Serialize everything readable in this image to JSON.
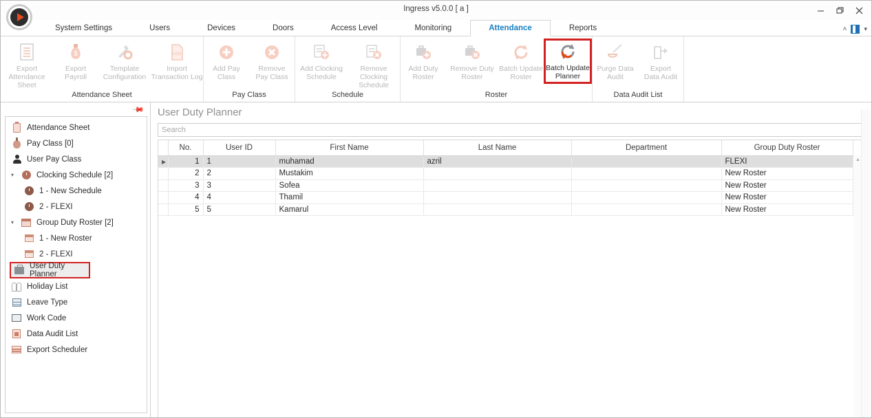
{
  "window": {
    "title": "Ingress v5.0.0 [ a ]",
    "minimize": "—",
    "restore": "❐",
    "close": "✕"
  },
  "logo": {
    "name": "ingress-logo"
  },
  "tabs": [
    {
      "label": "System Settings",
      "active": false
    },
    {
      "label": "Users",
      "active": false
    },
    {
      "label": "Devices",
      "active": false
    },
    {
      "label": "Doors",
      "active": false
    },
    {
      "label": "Access Level",
      "active": false
    },
    {
      "label": "Monitoring",
      "active": false
    },
    {
      "label": "Attendance",
      "active": true
    },
    {
      "label": "Reports",
      "active": false
    }
  ],
  "tabstrip_right": {
    "collapse_ribbon": "˄",
    "office_badge": "office-icon",
    "caret": "▾"
  },
  "ribbon": {
    "groups": [
      {
        "label": "Attendance Sheet",
        "items": [
          {
            "label": "Export\nAttendance Sheet",
            "line1": "Export",
            "line2": "Attendance Sheet",
            "icon": "export-attendance-sheet-icon",
            "enabled": false
          },
          {
            "label": "Export Payroll",
            "line1": "Export",
            "line2": "Payroll",
            "icon": "export-payroll-icon",
            "enabled": false
          },
          {
            "label": "Template Configuration",
            "line1": "Template",
            "line2": "Configuration",
            "icon": "template-configuration-icon",
            "enabled": false
          },
          {
            "label": "Import Transaction Log",
            "line1": "Import",
            "line2": "Transaction Log",
            "icon": "import-transaction-log-icon",
            "enabled": false
          }
        ]
      },
      {
        "label": "Pay Class",
        "items": [
          {
            "line1": "Add Pay",
            "line2": "Class",
            "icon": "add-pay-class-icon",
            "enabled": false
          },
          {
            "line1": "Remove",
            "line2": "Pay Class",
            "icon": "remove-pay-class-icon",
            "enabled": false
          }
        ]
      },
      {
        "label": "Schedule",
        "items": [
          {
            "line1": "Add Clocking",
            "line2": "Schedule",
            "icon": "add-clocking-schedule-icon",
            "enabled": false
          },
          {
            "line1": "Remove Clocking",
            "line2": "Schedule",
            "icon": "remove-clocking-schedule-icon",
            "enabled": false
          }
        ]
      },
      {
        "label": "Roster",
        "items": [
          {
            "line1": "Add Duty",
            "line2": "Roster",
            "icon": "add-duty-roster-icon",
            "enabled": false
          },
          {
            "line1": "Remove Duty",
            "line2": "Roster",
            "icon": "remove-duty-roster-icon",
            "enabled": false
          },
          {
            "line1": "Batch Update",
            "line2": "Roster",
            "icon": "batch-update-roster-icon",
            "enabled": false
          },
          {
            "line1": "Batch Update",
            "line2": "Planner",
            "icon": "batch-update-planner-icon",
            "enabled": true,
            "highlighted": true
          }
        ]
      },
      {
        "label": "Data Audit List",
        "items": [
          {
            "line1": "Purge Data",
            "line2": "Audit",
            "icon": "purge-data-audit-icon",
            "enabled": false
          },
          {
            "line1": "Export",
            "line2": "Data Audit",
            "icon": "export-data-audit-icon",
            "enabled": false
          }
        ]
      }
    ]
  },
  "sidebar": {
    "pin": "📌",
    "items": [
      {
        "label": "Attendance Sheet",
        "icon": "clipboard-icon",
        "level": 0,
        "expander": "",
        "selected": false
      },
      {
        "label": "Pay Class [0]",
        "icon": "money-bag-icon",
        "level": 0,
        "expander": "",
        "selected": false
      },
      {
        "label": "User Pay Class",
        "icon": "person-icon",
        "level": 0,
        "expander": "",
        "selected": false
      },
      {
        "label": "Clocking Schedule [2]",
        "icon": "clock-icon",
        "level": 0,
        "expander": "◢",
        "selected": false
      },
      {
        "label": "1 - New Schedule",
        "icon": "clock-dark-icon",
        "level": 1,
        "expander": "",
        "selected": false
      },
      {
        "label": "2 - FLEXI",
        "icon": "clock-dark-icon",
        "level": 1,
        "expander": "",
        "selected": false
      },
      {
        "label": "Group Duty Roster [2]",
        "icon": "calendar-icon",
        "level": 0,
        "expander": "◢",
        "selected": false
      },
      {
        "label": "1 - New Roster",
        "icon": "calendar-small-icon",
        "level": 1,
        "expander": "",
        "selected": false
      },
      {
        "label": "2 - FLEXI",
        "icon": "calendar-small-icon",
        "level": 1,
        "expander": "",
        "selected": false
      },
      {
        "label": "User Duty Planner",
        "icon": "briefcase-icon",
        "level": 0,
        "expander": "",
        "selected": true
      },
      {
        "label": "Holiday List",
        "icon": "holiday-icon",
        "level": 0,
        "expander": "",
        "selected": false
      },
      {
        "label": "Leave Type",
        "icon": "grid-icon",
        "level": 0,
        "expander": "",
        "selected": false
      },
      {
        "label": "Work Code",
        "icon": "screen-icon",
        "level": 0,
        "expander": "",
        "selected": false
      },
      {
        "label": "Data Audit List",
        "icon": "audit-icon",
        "level": 0,
        "expander": "",
        "selected": false
      },
      {
        "label": "Export Scheduler",
        "icon": "scheduler-icon",
        "level": 0,
        "expander": "",
        "selected": false
      }
    ]
  },
  "main": {
    "page_title": "User Duty Planner",
    "search": {
      "value": "",
      "placeholder": "Search"
    },
    "grid": {
      "columns": [
        "No.",
        "User ID",
        "First Name",
        "Last Name",
        "Department",
        "Group Duty Roster"
      ],
      "rows": [
        {
          "no": "1",
          "user_id": "1",
          "first_name": "muhamad",
          "last_name": "azril",
          "department": "",
          "group_duty_roster": "FLEXI",
          "selected": true
        },
        {
          "no": "2",
          "user_id": "2",
          "first_name": "Mustakim",
          "last_name": "",
          "department": "",
          "group_duty_roster": "New Roster",
          "selected": false
        },
        {
          "no": "3",
          "user_id": "3",
          "first_name": "Sofea",
          "last_name": "",
          "department": "",
          "group_duty_roster": "New Roster",
          "selected": false
        },
        {
          "no": "4",
          "user_id": "4",
          "first_name": "Thamil",
          "last_name": "",
          "department": "",
          "group_duty_roster": "New Roster",
          "selected": false
        },
        {
          "no": "5",
          "user_id": "5",
          "first_name": "Kamarul",
          "last_name": "",
          "department": "",
          "group_duty_roster": "New Roster",
          "selected": false
        }
      ]
    }
  },
  "colors": {
    "accent_orange": "#e8491f",
    "tab_active_blue": "#1a7fc1",
    "highlight_red": "#d32020",
    "row_selected_gray": "#dedede"
  }
}
